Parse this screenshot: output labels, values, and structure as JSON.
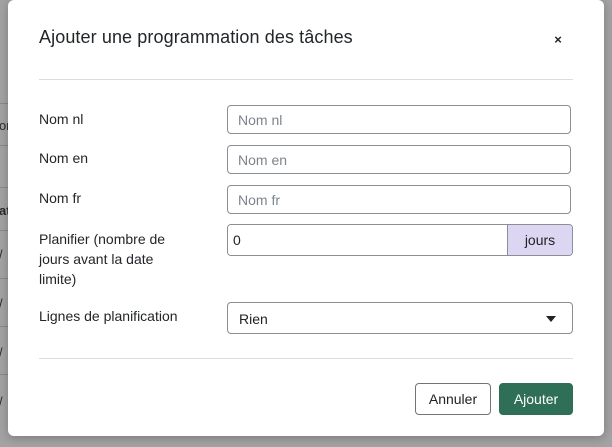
{
  "background": {
    "fragments": [
      {
        "text": "or",
        "bold": false
      },
      {
        "text": "at",
        "bold": true
      },
      {
        "text": "/",
        "bold": false
      },
      {
        "text": "/",
        "bold": false
      },
      {
        "text": "/",
        "bold": false
      },
      {
        "text": "/",
        "bold": false
      }
    ]
  },
  "modal": {
    "title": "Ajouter une programmation des tâches",
    "close_label": "×",
    "fields": {
      "name_nl": {
        "label": "Nom nl",
        "placeholder": "Nom nl",
        "value": ""
      },
      "name_en": {
        "label": "Nom en",
        "placeholder": "Nom en",
        "value": ""
      },
      "name_fr": {
        "label": "Nom fr",
        "placeholder": "Nom fr",
        "value": ""
      },
      "schedule_days": {
        "label": "Planifier (nombre de jours avant la date limite)",
        "value": "0",
        "addon": "jours"
      },
      "schedule_lines": {
        "label": "Lignes de planification",
        "selected": "Rien"
      }
    },
    "buttons": {
      "cancel": "Annuler",
      "submit": "Ajouter"
    }
  },
  "colors": {
    "primary": "#2f6f57",
    "addon_bg": "#dcd6f3"
  }
}
